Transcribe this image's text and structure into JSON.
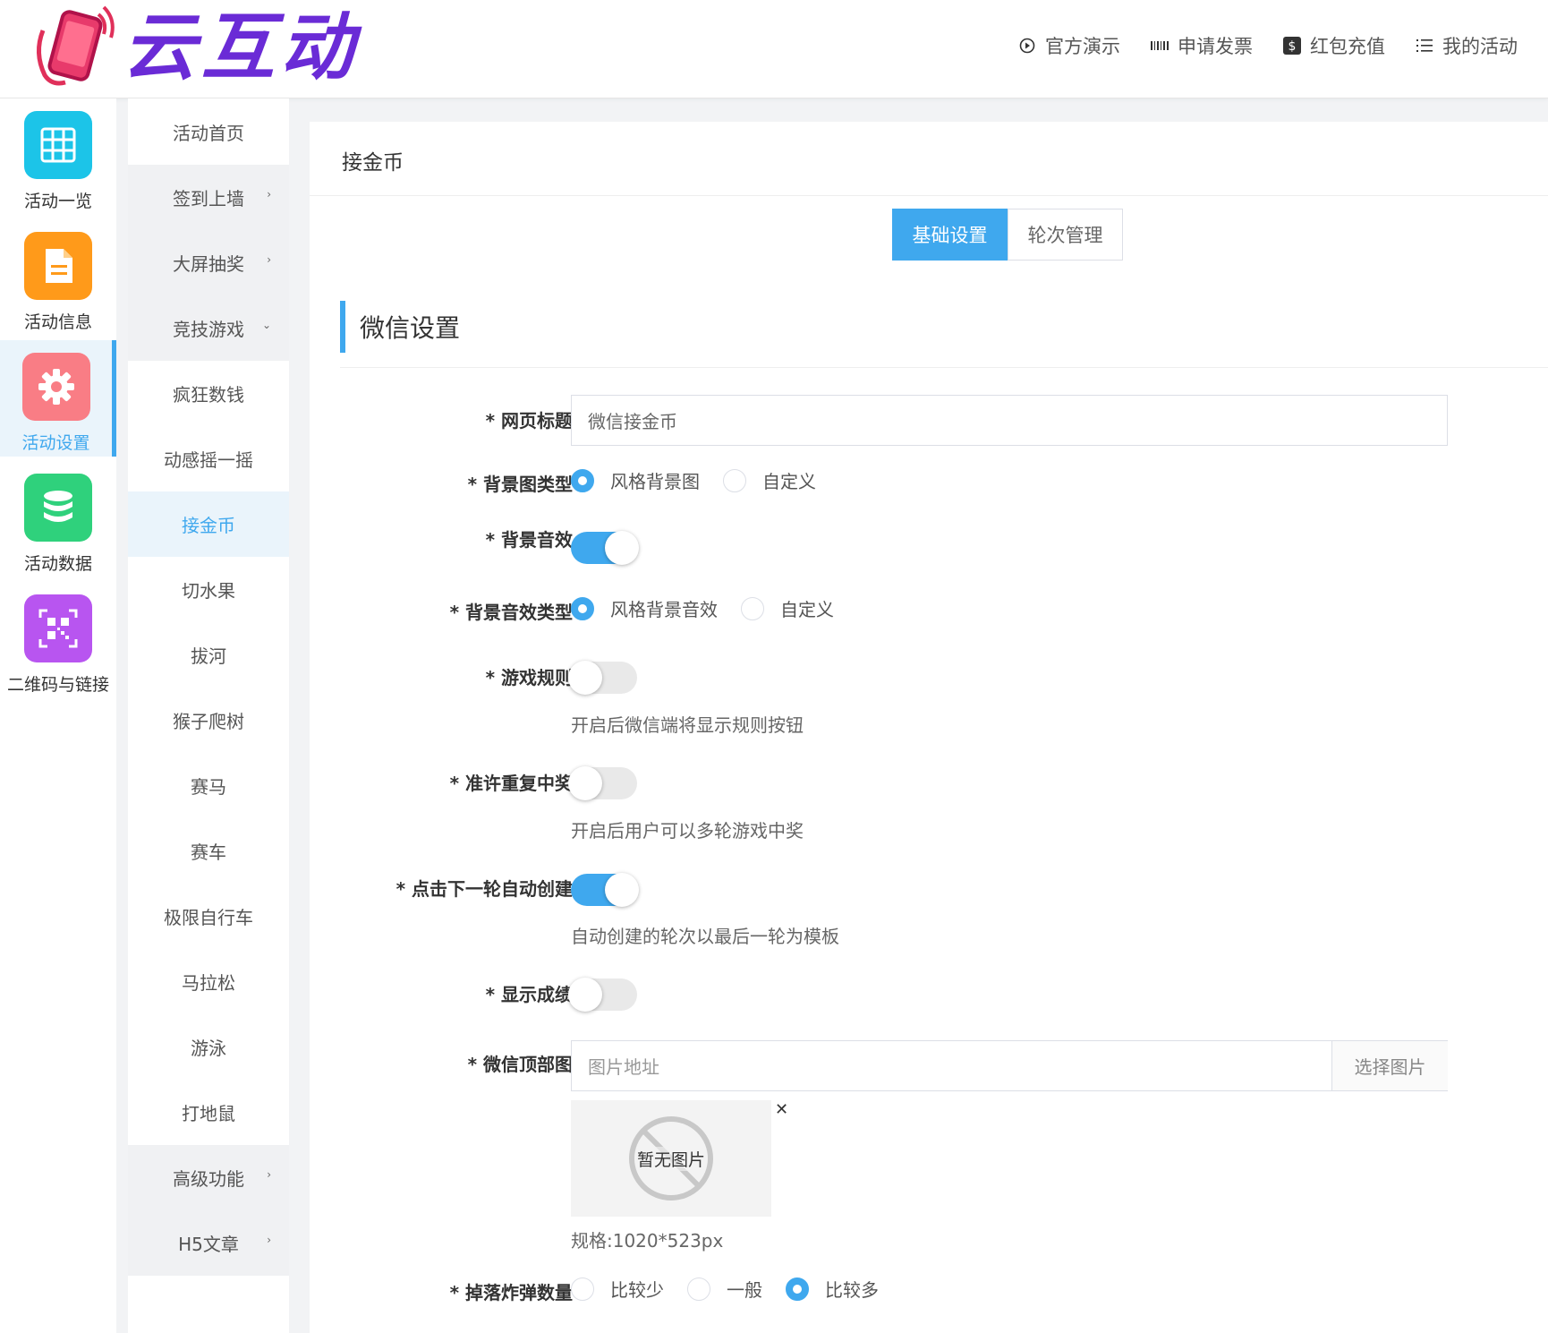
{
  "brand": {
    "name": "云互动"
  },
  "top_nav": [
    {
      "label": "官方演示",
      "icon": "play-circle-icon"
    },
    {
      "label": "申请发票",
      "icon": "barcode-icon"
    },
    {
      "label": "红包充值",
      "icon": "dollar-icon"
    },
    {
      "label": "我的活动",
      "icon": "list-icon"
    }
  ],
  "sidebar": [
    {
      "label": "活动一览",
      "color": "#1cc4e8",
      "icon": "grid-icon"
    },
    {
      "label": "活动信息",
      "color": "#ff9a1a",
      "icon": "document-icon"
    },
    {
      "label": "活动设置",
      "color": "#f97d85",
      "icon": "gear-icon",
      "active": true
    },
    {
      "label": "活动数据",
      "color": "#2fd17c",
      "icon": "database-icon"
    },
    {
      "label": "二维码与链接",
      "color": "#b855f0",
      "icon": "qrcode-icon"
    }
  ],
  "submenu": [
    {
      "label": "活动首页"
    },
    {
      "label": "签到上墙",
      "arrow": "›"
    },
    {
      "label": "大屏抽奖",
      "arrow": "›"
    },
    {
      "label": "竞技游戏",
      "arrow": "⌄"
    },
    {
      "label": "疯狂数钱"
    },
    {
      "label": "动感摇一摇"
    },
    {
      "label": "接金币",
      "active": true
    },
    {
      "label": "切水果"
    },
    {
      "label": "拔河"
    },
    {
      "label": "猴子爬树"
    },
    {
      "label": "赛马"
    },
    {
      "label": "赛车"
    },
    {
      "label": "极限自行车"
    },
    {
      "label": "马拉松"
    },
    {
      "label": "游泳"
    },
    {
      "label": "打地鼠"
    },
    {
      "label": "高级功能",
      "arrow": "›"
    },
    {
      "label": "H5文章",
      "arrow": "›"
    }
  ],
  "panel": {
    "title": "接金币",
    "tabs": [
      {
        "label": "基础设置",
        "active": true
      },
      {
        "label": "轮次管理"
      }
    ],
    "section_title": "微信设置"
  },
  "form": {
    "page_title": {
      "label": "* 网页标题",
      "value": "微信接金币"
    },
    "bg_type": {
      "label": "* 背景图类型",
      "options": [
        "风格背景图",
        "自定义"
      ],
      "selected": 0
    },
    "bg_sound": {
      "label": "* 背景音效",
      "on": true
    },
    "bg_sound_type": {
      "label": "* 背景音效类型",
      "options": [
        "风格背景音效",
        "自定义"
      ],
      "selected": 0
    },
    "game_rules": {
      "label": "* 游戏规则",
      "on": false,
      "hint": "开启后微信端将显示规则按钮"
    },
    "repeat_win": {
      "label": "* 准许重复中奖",
      "on": false,
      "hint": "开启后用户可以多轮游戏中奖"
    },
    "auto_create": {
      "label": "* 点击下一轮自动创建",
      "on": true,
      "hint": "自动创建的轮次以最后一轮为模板"
    },
    "show_score": {
      "label": "* 显示成绩",
      "on": false
    },
    "top_image": {
      "label": "* 微信顶部图",
      "placeholder": "图片地址",
      "button": "选择图片",
      "empty_text": "暂无图片",
      "spec": "规格:1020*523px",
      "close": "✕"
    },
    "bomb_count": {
      "label": "* 掉落炸弹数量",
      "options": [
        "比较少",
        "一般",
        "比较多"
      ],
      "selected": 2
    }
  }
}
